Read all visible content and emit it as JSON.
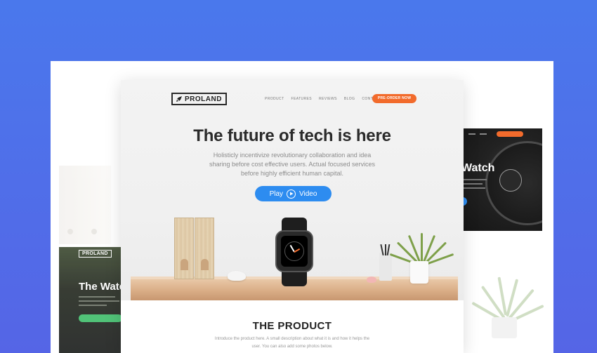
{
  "main_page": {
    "logo_text": "PROLAND",
    "nav": [
      "PRODUCT",
      "FEATURES",
      "REVIEWS",
      "BLOG",
      "CONTACT"
    ],
    "preorder_label": "PRE-ORDER NOW",
    "headline": "The future of tech is here",
    "subtext": "Holisticly incentivize revolutionary collaboration and idea sharing before cost effective users. Actual focused services before highly efficient human capital.",
    "play_label_left": "Play",
    "play_label_right": "Video",
    "product_title": "THE PRODUCT",
    "product_desc": "Introduce the product here. A small description about what it is and how it helps the user. You can also add some photos below."
  },
  "left_preview": {
    "logo_text": "PROLAND",
    "title": "The Watch"
  },
  "right_preview": {
    "title": "Watch"
  },
  "colors": {
    "background": "#4a78ec",
    "accent_orange": "#f26b2c",
    "accent_blue": "#2d8cf0"
  }
}
